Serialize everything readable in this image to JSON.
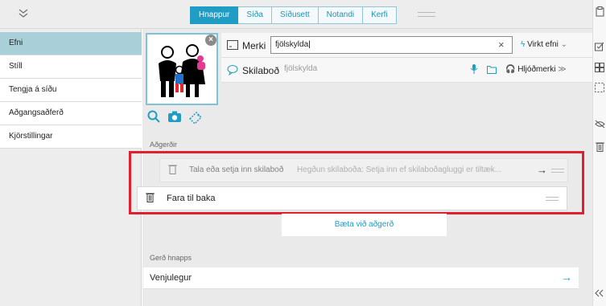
{
  "topbar": {
    "collapse_icon": "double-chevron-down-icon",
    "tabs": [
      {
        "label": "Hnappur",
        "active": true
      },
      {
        "label": "Síða",
        "active": false
      },
      {
        "label": "Síðusett",
        "active": false
      },
      {
        "label": "Notandi",
        "active": false
      },
      {
        "label": "Kerfi",
        "active": false
      }
    ]
  },
  "sidebar": {
    "items": [
      {
        "label": "Efni",
        "active": true
      },
      {
        "label": "Stíll",
        "active": false
      },
      {
        "label": "Tengja á síðu",
        "active": false
      },
      {
        "label": "Aðgangsaðferð",
        "active": false
      },
      {
        "label": "Kjörstillingar",
        "active": false
      }
    ]
  },
  "content": {
    "label_row": {
      "label": "Merki",
      "value": "fjölskylda",
      "clear": "×",
      "effect_button": "Virkt efni"
    },
    "message_row": {
      "label": "Skilaboð",
      "placeholder": "fjölskylda",
      "sound_button": "Hljóðmerki"
    },
    "actions": {
      "section_label": "Aðgerðir",
      "ghost_row": {
        "title": "Tala eða setja inn skilaboð",
        "desc": "Hegðun skilaboða: Setja inn ef skilaboðagluggi er tiltæk...",
        "arrow": "→"
      },
      "row": {
        "label": "Fara til baka"
      },
      "add_label": "Bæta við aðgerð"
    },
    "button_type": {
      "section_label": "Gerð hnapps",
      "value": "Venjulegur",
      "arrow": "→"
    }
  },
  "colors": {
    "accent": "#1f9dc4",
    "highlight": "#e1202f",
    "sidebar_active": "#a9cfd9"
  }
}
